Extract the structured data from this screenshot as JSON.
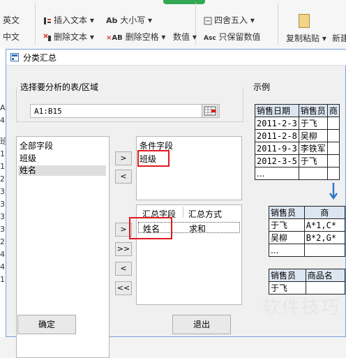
{
  "ribbon": {
    "col1": [
      "英文",
      "中文"
    ],
    "insert_text": "插入文本",
    "delete_text": "删除文本",
    "case": "大小写",
    "delete_space": "删除空格",
    "round": "四舍五入",
    "keep_values": "只保留数值",
    "number": "数值",
    "copy_paste": "复制粘贴",
    "new": "新建"
  },
  "sheet": {
    "rows": [
      "A",
      "4",
      "班",
      "1",
      "1",
      "2",
      "3",
      "3",
      "3",
      "3",
      "2",
      "4",
      "4",
      "1"
    ]
  },
  "dialog": {
    "title": "分类汇总",
    "select_area_label": "选择要分析的表/区域",
    "range_value": "A1:B15",
    "example_label": "示例",
    "all_fields": {
      "header": "全部字段",
      "items": [
        "班级",
        "姓名"
      ]
    },
    "condition_fields": {
      "header": "条件字段",
      "items": [
        "班级"
      ]
    },
    "summary_fields": {
      "col1": "汇总字段",
      "col2": "汇总方式",
      "rows": [
        {
          "field": "姓名",
          "method": "求和"
        }
      ]
    },
    "move_buttons": {
      "right": ">",
      "left": "<",
      "all_right": ">>",
      "all_left": "<<"
    },
    "ok": "确定",
    "cancel": "退出"
  },
  "example": {
    "table1": {
      "headers": [
        "销售日期",
        "销售员",
        "商"
      ],
      "rows": [
        [
          "2011-2-3",
          "于飞",
          ""
        ],
        [
          "2011-2-8",
          "吴柳",
          ""
        ],
        [
          "2011-9-3",
          "李铁军",
          ""
        ],
        [
          "2012-3-5",
          "于飞",
          ""
        ],
        [
          "...",
          "",
          ""
        ]
      ]
    },
    "table2": {
      "headers": [
        "销售员",
        "商"
      ],
      "rows": [
        [
          "于飞",
          "A*1,C*"
        ],
        [
          "吴柳",
          "B*2,G*"
        ],
        [
          "...",
          ""
        ]
      ]
    },
    "table3": {
      "headers": [
        "销售员",
        "商品名"
      ],
      "rows": [
        [
          "于飞",
          ""
        ]
      ]
    }
  },
  "watermark": "软件技巧",
  "colors": {
    "accent": "#2f6fb8",
    "highlight": "#e0191e",
    "arrow": "#2e75c9"
  }
}
